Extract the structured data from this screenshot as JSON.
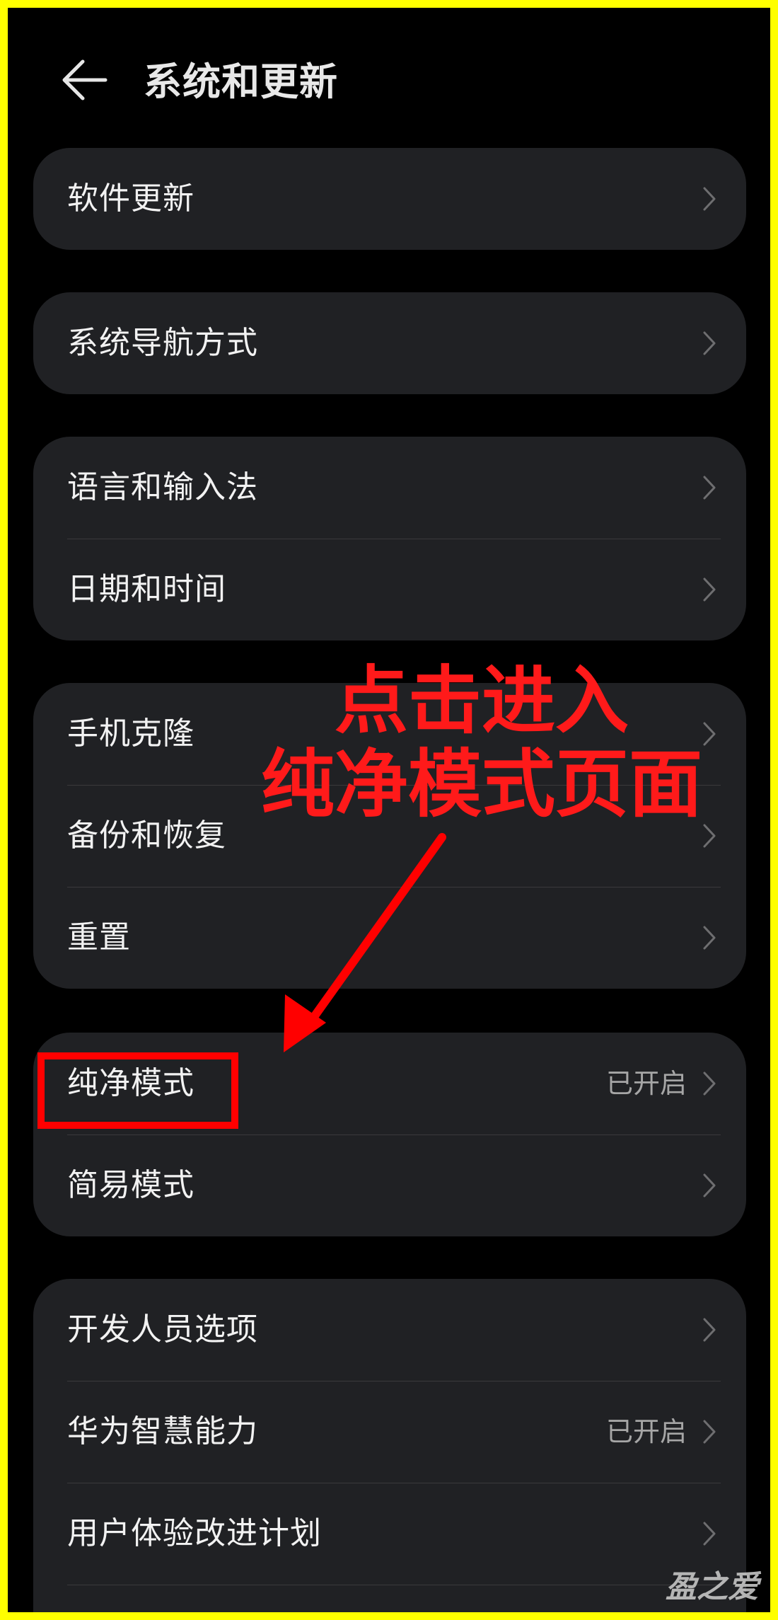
{
  "header": {
    "title": "系统和更新"
  },
  "groups": [
    {
      "items": [
        {
          "label": "软件更新",
          "value": ""
        }
      ]
    },
    {
      "items": [
        {
          "label": "系统导航方式",
          "value": ""
        }
      ]
    },
    {
      "items": [
        {
          "label": "语言和输入法",
          "value": ""
        },
        {
          "label": "日期和时间",
          "value": ""
        }
      ]
    },
    {
      "items": [
        {
          "label": "手机克隆",
          "value": ""
        },
        {
          "label": "备份和恢复",
          "value": ""
        },
        {
          "label": "重置",
          "value": ""
        }
      ]
    },
    {
      "items": [
        {
          "label": "纯净模式",
          "value": "已开启"
        },
        {
          "label": "简易模式",
          "value": ""
        }
      ]
    },
    {
      "items": [
        {
          "label": "开发人员选项",
          "value": ""
        },
        {
          "label": "华为智慧能力",
          "value": "已开启"
        },
        {
          "label": "用户体验改进计划",
          "value": ""
        }
      ]
    }
  ],
  "annotation": {
    "line1": "点击进入",
    "line2": "纯净模式页面"
  },
  "watermark": "盈之爱",
  "colors": {
    "border": "#ffff00",
    "background": "#000000",
    "card": "#202124",
    "annotation": "#ff0000"
  },
  "icons": {
    "back": "arrow-left-icon",
    "chevron": "chevron-right-icon"
  }
}
